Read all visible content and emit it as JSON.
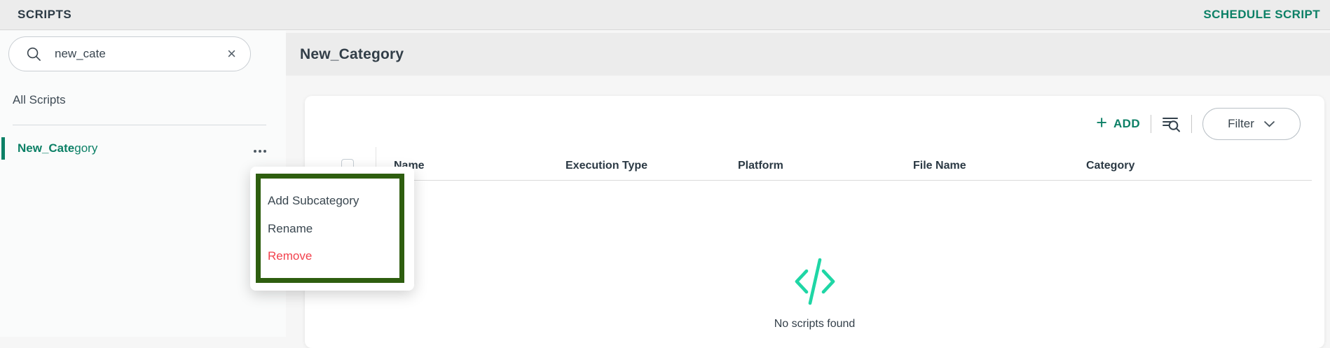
{
  "topbar": {
    "title": "SCRIPTS",
    "schedule_script_label": "SCHEDULE SCRIPT"
  },
  "sidebar": {
    "search": {
      "value": "new_cate",
      "placeholder": ""
    },
    "all_scripts_label": "All Scripts",
    "category": {
      "match": "New_Cate",
      "rest": "gory"
    }
  },
  "context_menu": {
    "items": [
      {
        "label": "Add Subcategory"
      },
      {
        "label": "Rename"
      },
      {
        "label": "Remove"
      }
    ]
  },
  "main": {
    "heading": "New_Category",
    "toolbar": {
      "plus_glyph": "+",
      "add_label": "ADD",
      "filter_label": "Filter"
    },
    "table": {
      "columns": [
        "Name",
        "Execution Type",
        "Platform",
        "File Name",
        "Category"
      ]
    },
    "empty_message": "No scripts found"
  },
  "icons": {
    "search": "magnifier",
    "clear": "×",
    "more_options": "three-dots",
    "add_plus": "+",
    "list_search": "list-with-magnifier",
    "filter_chevron": "chevron-down",
    "empty_code": "</>"
  },
  "colors": {
    "accent_teal": "#0c8066",
    "mint_icon": "#1fd6a5",
    "danger_red": "#f2414d",
    "annotation_green": "#2e5e0f",
    "bar_gray": "#ececec"
  }
}
